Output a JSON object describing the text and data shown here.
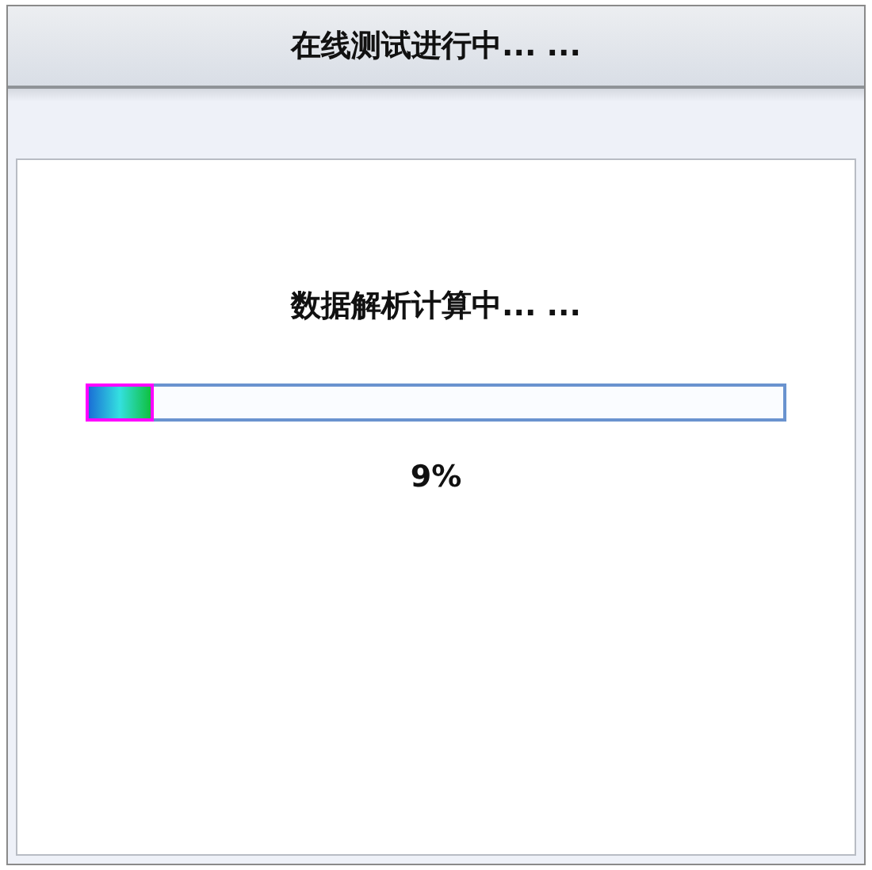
{
  "window": {
    "title": "在线测试进行中... ..."
  },
  "progress": {
    "message": "数据解析计算中... ...",
    "level": 0.09,
    "percent": "9%"
  }
}
